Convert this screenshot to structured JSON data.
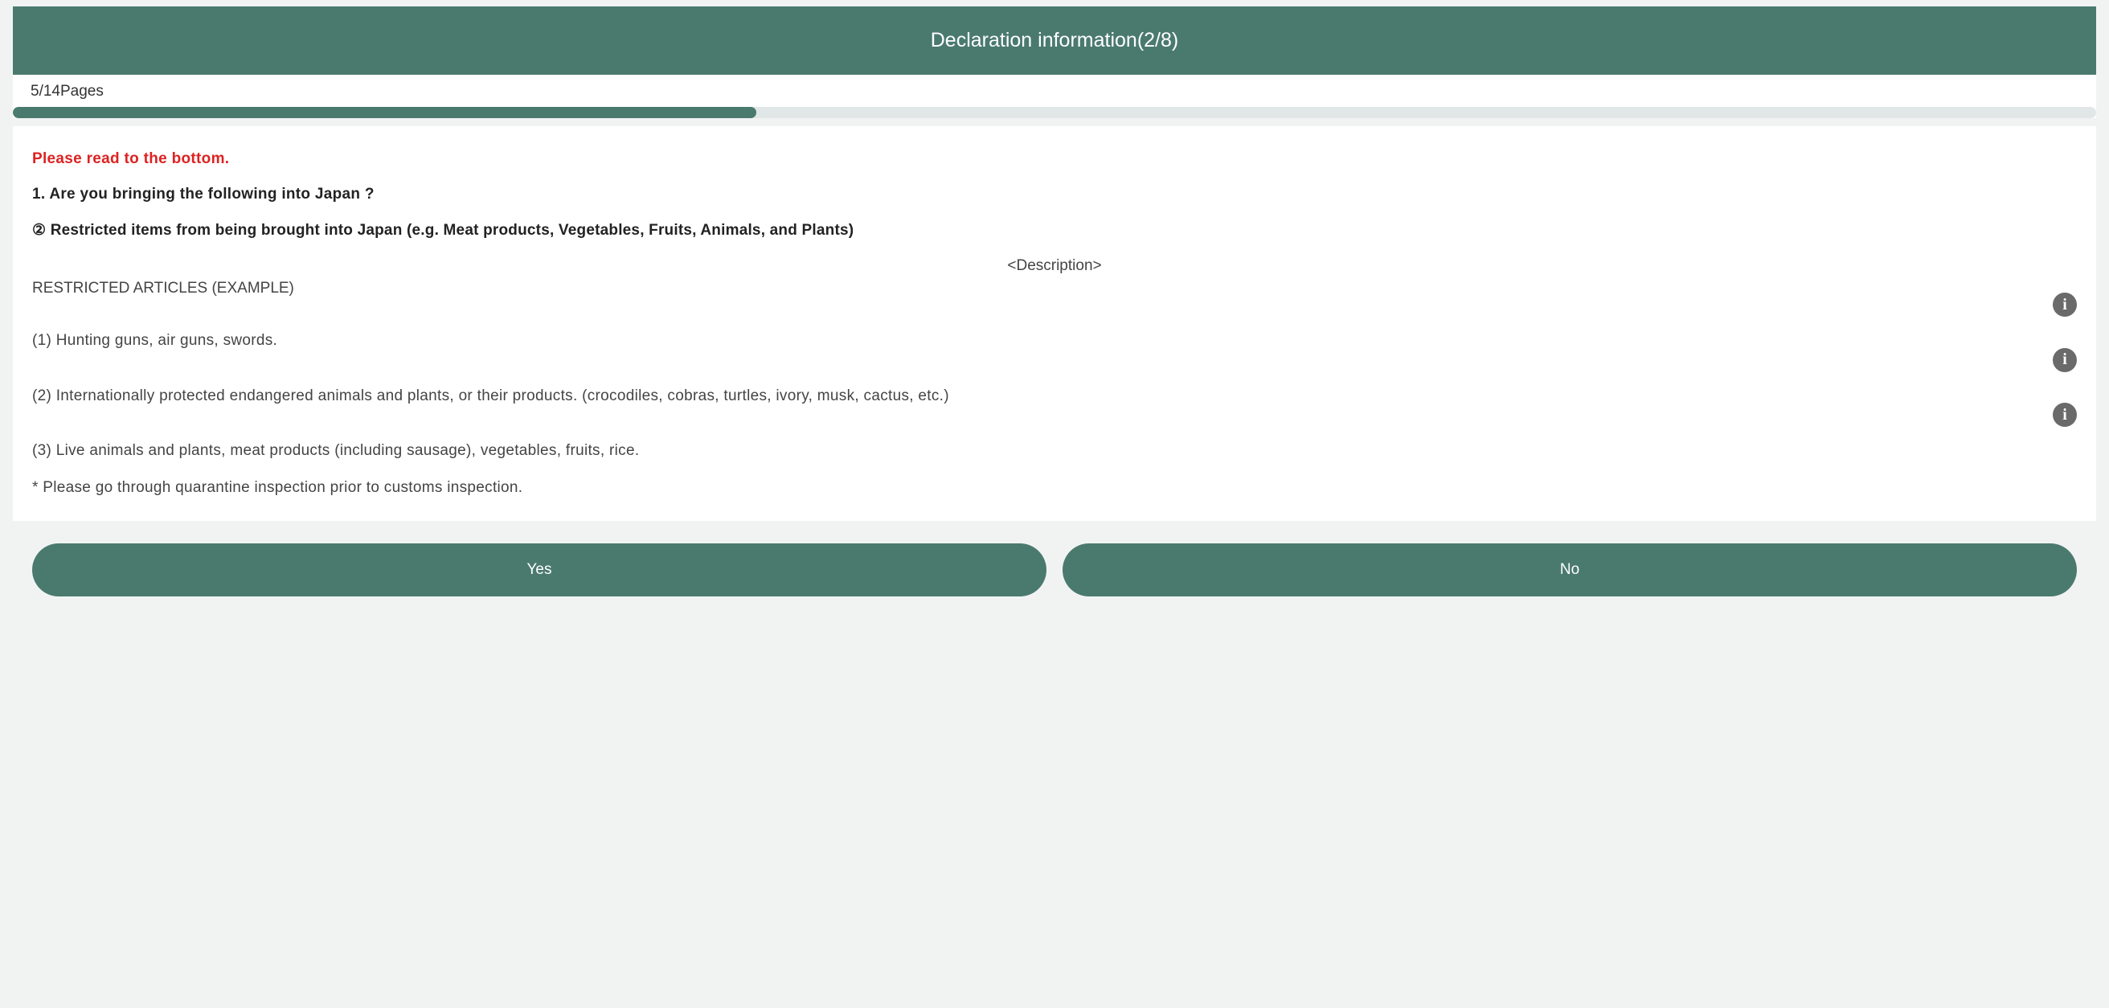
{
  "header": {
    "title": "Declaration information(2/8)"
  },
  "progress": {
    "label": "5/14Pages",
    "current": 5,
    "total": 14,
    "percent": 35.7
  },
  "content": {
    "notice": "Please read to the bottom.",
    "question1": "1. Are you bringing the following into Japan ?",
    "question2": "② Restricted items from being brought into Japan (e.g. Meat products, Vegetables, Fruits, Animals, and Plants)",
    "descLabel": "<Description>",
    "descTitle": "RESTRICTED ARTICLES (EXAMPLE)",
    "items": [
      "(1) Hunting guns, air guns, swords.",
      "(2) Internationally protected endangered animals and plants, or their products. (crocodiles, cobras, turtles, ivory, musk, cactus, etc.)",
      "(3) Live animals and plants, meat products (including sausage), vegetables, fruits, rice."
    ],
    "note": "* Please go through quarantine inspection prior to customs inspection."
  },
  "buttons": {
    "yes": "Yes",
    "no": "No"
  }
}
